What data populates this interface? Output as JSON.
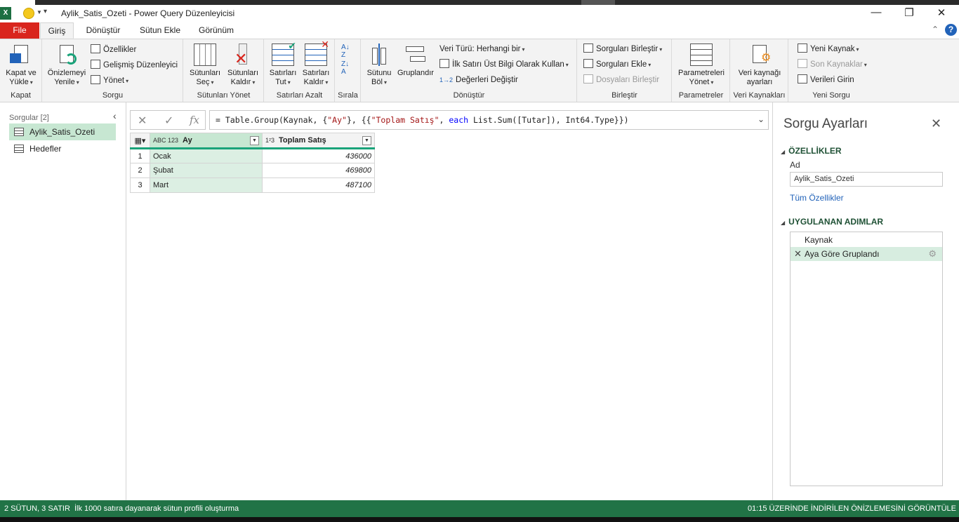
{
  "window": {
    "title": "Aylik_Satis_Ozeti - Power Query Düzenleyicisi",
    "app_icon": "excel-icon"
  },
  "tabs": [
    "File",
    "Giriş",
    "Dönüştür",
    "Sütun Ekle",
    "Görünüm"
  ],
  "ribbon": {
    "kapat": {
      "label": "Kapat",
      "close_load": "Kapat ve\nYükle"
    },
    "sorgu": {
      "label": "Sorgu",
      "refresh": "Önizlemeyi\nYenile",
      "properties": "Özellikler",
      "advanced_editor": "Gelişmiş Düzenleyici",
      "manage": "Yönet"
    },
    "columns": {
      "label": "Sütunları Yönet",
      "choose": "Sütunları\nSeç",
      "remove": "Sütunları\nKaldır"
    },
    "rows": {
      "label": "Satırları Azalt",
      "keep": "Satırları\nTut",
      "remove": "Satırları\nKaldır"
    },
    "sort": {
      "label": "Sırala"
    },
    "transform": {
      "label": "Dönüştür",
      "split": "Sütunu\nBöl",
      "group": "Gruplandır",
      "data_type": "Veri Türü: Herhangi bir",
      "first_row_header": "İlk Satırı Üst Bilgi Olarak Kullan",
      "replace": "Değerleri Değiştir"
    },
    "combine": {
      "label": "Birleştir",
      "merge": "Sorguları Birleştir",
      "append": "Sorguları Ekle",
      "combine_files": "Dosyaları Birleştir"
    },
    "parameters": {
      "label": "Parametreler",
      "manage": "Parametreleri\nYönet"
    },
    "data_sources": {
      "label": "Veri Kaynakları",
      "settings": "Veri kaynağı\nayarları"
    },
    "new_query": {
      "label": "Yeni Sorgu",
      "new_source": "Yeni Kaynak",
      "recent_sources": "Son Kaynaklar",
      "enter_data": "Verileri Girin"
    }
  },
  "queries_pane": {
    "header": "Sorgular [2]",
    "items": [
      {
        "name": "Aylik_Satis_Ozeti",
        "selected": true
      },
      {
        "name": "Hedefler",
        "selected": false
      }
    ]
  },
  "formula_bar": {
    "prefix": "= Table.Group(Kaynak, {",
    "s1": "\"Ay\"",
    "mid1": "}, {{",
    "s2": "\"Toplam Satış\"",
    "mid2": ", ",
    "kw": "each",
    "suffix": " List.Sum([Tutar]), Int64.Type}})"
  },
  "grid": {
    "columns": [
      {
        "name": "Ay",
        "type_icon": "ABC 123"
      },
      {
        "name": "Toplam Satış",
        "type_icon": "1²3"
      }
    ],
    "rows": [
      {
        "n": "1",
        "ay": "Ocak",
        "toplam": "436000"
      },
      {
        "n": "2",
        "ay": "Şubat",
        "toplam": "469800"
      },
      {
        "n": "3",
        "ay": "Mart",
        "toplam": "487100"
      }
    ]
  },
  "settings_pane": {
    "title": "Sorgu Ayarları",
    "properties_header": "ÖZELLİKLER",
    "name_label": "Ad",
    "name_value": "Aylik_Satis_Ozeti",
    "all_properties": "Tüm Özellikler",
    "steps_header": "UYGULANAN ADIMLAR",
    "steps": [
      "Kaynak",
      "Aya Göre Gruplandı"
    ]
  },
  "status": {
    "left": "2 SÜTUN, 3 SATIR",
    "profile": "İlk 1000 satıra dayanarak sütun profili oluşturma",
    "right": "01:15 ÜZERİNDE İNDİRİLEN ÖNİZLEMESİNİ GÖRÜNTÜLE"
  },
  "colors": {
    "accent": "#217346",
    "file_tab": "#d9251d",
    "selection": "#c7e7d2"
  }
}
